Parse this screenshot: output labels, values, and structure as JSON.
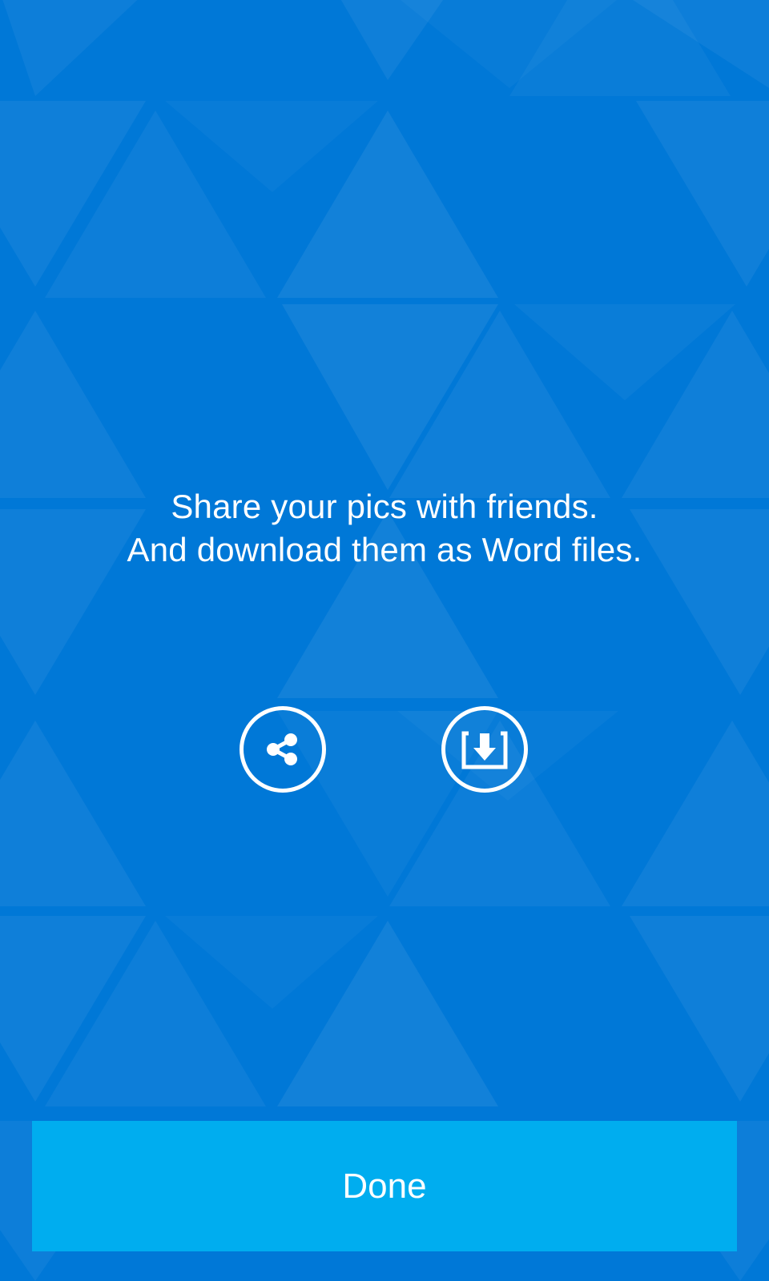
{
  "message": {
    "line1": "Share your pics with friends.",
    "line2": "And download them as Word files."
  },
  "actions": {
    "share_icon": "share-icon",
    "download_icon": "download-icon"
  },
  "done_button": {
    "label": "Done"
  },
  "colors": {
    "background": "#0078d7",
    "done_button": "#00adef",
    "foreground": "#ffffff"
  }
}
